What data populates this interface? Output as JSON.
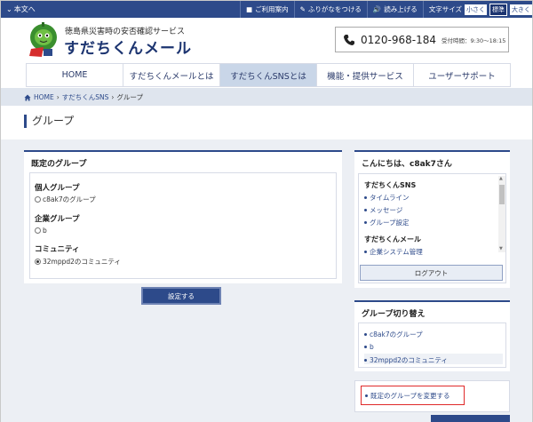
{
  "topbar": {
    "skip": "本文へ",
    "links": [
      "ご利用案内",
      "ふりがなをつける",
      "読み上げる"
    ],
    "font_size_label": "文字サイズ",
    "font_sizes": [
      "小さく",
      "標準",
      "大きく"
    ],
    "font_size_current": "標準"
  },
  "header": {
    "subtitle": "徳島県災害時の安否確認サービス",
    "brand": "すだちくんメール",
    "phone": "0120-968-184",
    "hours": "受付時間：9:30〜18:15"
  },
  "nav": {
    "items": [
      "HOME",
      "すだちくんメールとは",
      "すだちくんSNSとは",
      "機能・提供サービス",
      "ユーザーサポート"
    ],
    "active_index": 2
  },
  "breadcrumb": [
    "HOME",
    "すだちくんSNS",
    "グループ"
  ],
  "page_title": "グループ",
  "default_group": {
    "heading": "既定のグループ",
    "sections": [
      {
        "title": "個人グループ",
        "options": [
          {
            "label": "c8ak7のグループ",
            "selected": false
          }
        ]
      },
      {
        "title": "企業グループ",
        "options": [
          {
            "label": "b",
            "selected": false
          }
        ]
      },
      {
        "title": "コミュニティ",
        "options": [
          {
            "label": "32mppd2のコミュニティ",
            "selected": true
          }
        ]
      }
    ],
    "submit_label": "設定する"
  },
  "user_panel": {
    "greeting": "こんにちは、c8ak7さん",
    "sections": [
      {
        "title": "すだちくんSNS",
        "links": [
          "タイムライン",
          "メッセージ",
          "グループ設定"
        ]
      },
      {
        "title": "すだちくんメール",
        "links": [
          "企業システム管理"
        ]
      }
    ],
    "logout_label": "ログアウト"
  },
  "group_switch": {
    "heading": "グループ切り替え",
    "items": [
      "c8ak7のグループ",
      "b",
      "32mppd2のコミュニティ"
    ],
    "current_index": 2
  },
  "change_default_link": "既定のグループを変更する",
  "colors": {
    "primary": "#2d4a8a",
    "nav_active": "#c9d6e8",
    "highlight_border": "#e02a2a"
  }
}
